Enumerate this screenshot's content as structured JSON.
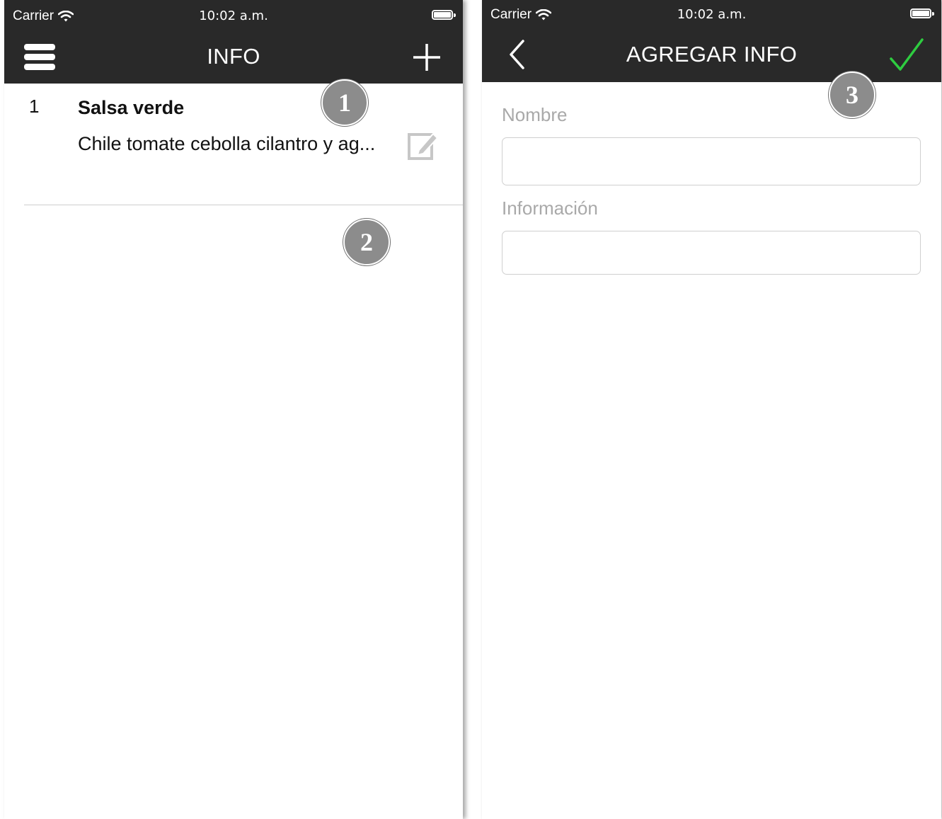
{
  "colors": {
    "bar_background": "#292929",
    "bar_text": "#ffffff",
    "confirm_green": "#2ecc40",
    "callout_fill": "#8c8c8c",
    "label_gray": "#a9a9a9",
    "divider": "#cfcfcf"
  },
  "left_screen": {
    "status": {
      "carrier": "Carrier",
      "time": "10:02 a.m."
    },
    "navbar": {
      "title": "INFO",
      "menu_icon": "hamburger-menu-icon",
      "add_icon": "plus-icon"
    },
    "list": {
      "items": [
        {
          "number": "1",
          "title": "Salsa verde",
          "description": "Chile tomate cebolla cilantro y ag...",
          "action_icon": "edit-icon"
        }
      ]
    },
    "callouts": [
      "1",
      "2"
    ]
  },
  "right_screen": {
    "status": {
      "carrier": "Carrier",
      "time": "10:02 a.m."
    },
    "navbar": {
      "title": "AGREGAR INFO",
      "back_icon": "chevron-left-icon",
      "confirm_icon": "checkmark-icon"
    },
    "form": {
      "name_label": "Nombre",
      "name_value": "",
      "info_label": "Información",
      "info_value": ""
    },
    "callouts": [
      "3"
    ]
  }
}
